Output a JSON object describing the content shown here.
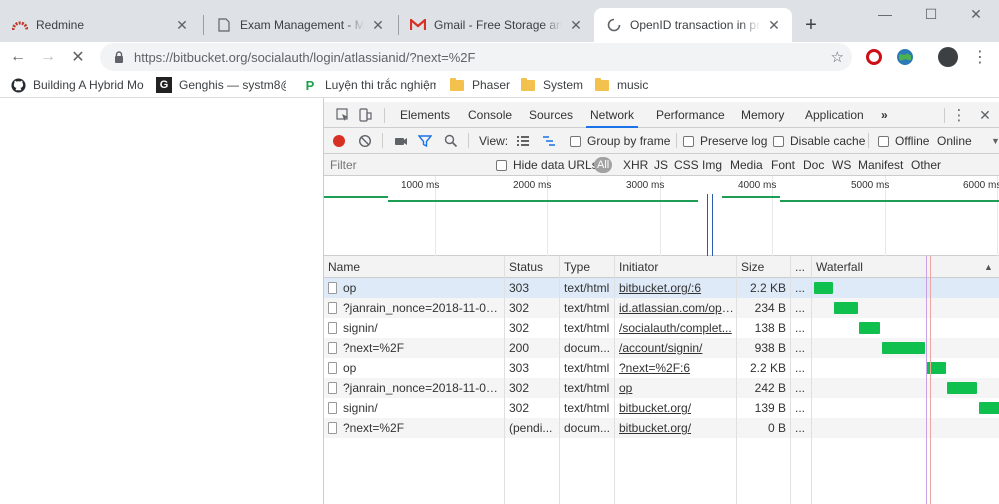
{
  "tabs": [
    {
      "title": "Redmine",
      "icon": "redmine-icon",
      "close": "✕"
    },
    {
      "title": "Exam Management - My A",
      "icon": "document-icon",
      "close": "✕"
    },
    {
      "title": "Gmail - Free Storage and E",
      "icon": "gmail-icon",
      "close": "✕"
    },
    {
      "title": "OpenID transaction in prog",
      "icon": "loading-spinner-icon",
      "close": "✕",
      "active": true
    }
  ],
  "new_tab_label": "+",
  "window_controls": {
    "minimize": "—",
    "maximize": "☐",
    "close": "✕"
  },
  "toolbar": {
    "back": "←",
    "forward": "→",
    "stop": "✕",
    "url_host": "https://bitbucket.org",
    "url_path": "/socialauth/login/atlassianid/?next=%2F",
    "star": "☆",
    "menu": "⋮"
  },
  "bookmarks": [
    {
      "label": "Building A Hybrid Mo",
      "icon": "github-icon"
    },
    {
      "label": "Genghis — systm8@",
      "icon": "genghis-icon"
    },
    {
      "label": "Luyện thi trắc nghiệm",
      "icon": "p-icon"
    },
    {
      "label": "Phaser",
      "icon": "folder-icon"
    },
    {
      "label": "System",
      "icon": "folder-icon"
    },
    {
      "label": "music",
      "icon": "folder-icon"
    }
  ],
  "devtools": {
    "tabs": [
      "Elements",
      "Console",
      "Sources",
      "Network",
      "Performance",
      "Memory",
      "Application"
    ],
    "active_tab": "Network",
    "more": "»",
    "menu": "⋮",
    "close": "✕",
    "network_toolbar": {
      "view_label": "View:",
      "group_by_frame": "Group by frame",
      "preserve_log": "Preserve log",
      "disable_cache": "Disable cache",
      "offline": "Offline",
      "throttle": "Online"
    },
    "filter": {
      "placeholder": "Filter",
      "hide_data_urls": "Hide data URLs",
      "types": [
        "All",
        "XHR",
        "JS",
        "CSS",
        "Img",
        "Media",
        "Font",
        "Doc",
        "WS",
        "Manifest",
        "Other"
      ]
    },
    "overview_ticks": [
      "1000 ms",
      "2000 ms",
      "3000 ms",
      "4000 ms",
      "5000 ms",
      "6000 ms"
    ],
    "columns": [
      "Name",
      "Status",
      "Type",
      "Initiator",
      "Size",
      "...",
      "Waterfall"
    ],
    "sort_indicator": "▲",
    "rows": [
      {
        "name": "op",
        "status": "303",
        "type": "text/html",
        "initiator": "bitbucket.org/:6",
        "size": "2.2 KB",
        "more": "...",
        "wf_start_ms": 0,
        "wf_end_ms": 170
      },
      {
        "name": "?janrain_nonce=2018-11-01T...",
        "status": "302",
        "type": "text/html",
        "initiator": "id.atlassian.com/ope...",
        "size": "234 B",
        "more": "...",
        "wf_start_ms": 180,
        "wf_end_ms": 400
      },
      {
        "name": "signin/",
        "status": "302",
        "type": "text/html",
        "initiator": "/socialauth/complet...",
        "size": "138 B",
        "more": "...",
        "wf_start_ms": 410,
        "wf_end_ms": 610
      },
      {
        "name": "?next=%2F",
        "status": "200",
        "type": "docum...",
        "initiator": "/account/signin/",
        "size": "938 B",
        "more": "...",
        "wf_start_ms": 620,
        "wf_end_ms": 1020
      },
      {
        "name": "op",
        "status": "303",
        "type": "text/html",
        "initiator": "?next=%2F:6",
        "size": "2.2 KB",
        "more": "...",
        "wf_start_ms": 1030,
        "wf_end_ms": 1210
      },
      {
        "name": "?janrain_nonce=2018-11-01T...",
        "status": "302",
        "type": "text/html",
        "initiator": "op",
        "size": "242 B",
        "more": "...",
        "wf_start_ms": 1220,
        "wf_end_ms": 1500
      },
      {
        "name": "signin/",
        "status": "302",
        "type": "text/html",
        "initiator": "bitbucket.org/",
        "size": "139 B",
        "more": "...",
        "wf_start_ms": 1510,
        "wf_end_ms": 1720
      },
      {
        "name": "?next=%2F",
        "status": "(pendi...",
        "type": "docum...",
        "initiator": "bitbucket.org/",
        "size": "0 B",
        "more": "...",
        "wf_start_ms": null,
        "wf_end_ms": null
      }
    ]
  },
  "colors": {
    "accent": "#1a73e8",
    "waterfall_bar": "#0fc04f",
    "record": "#d93025",
    "overview_line": "#1e9e55"
  }
}
